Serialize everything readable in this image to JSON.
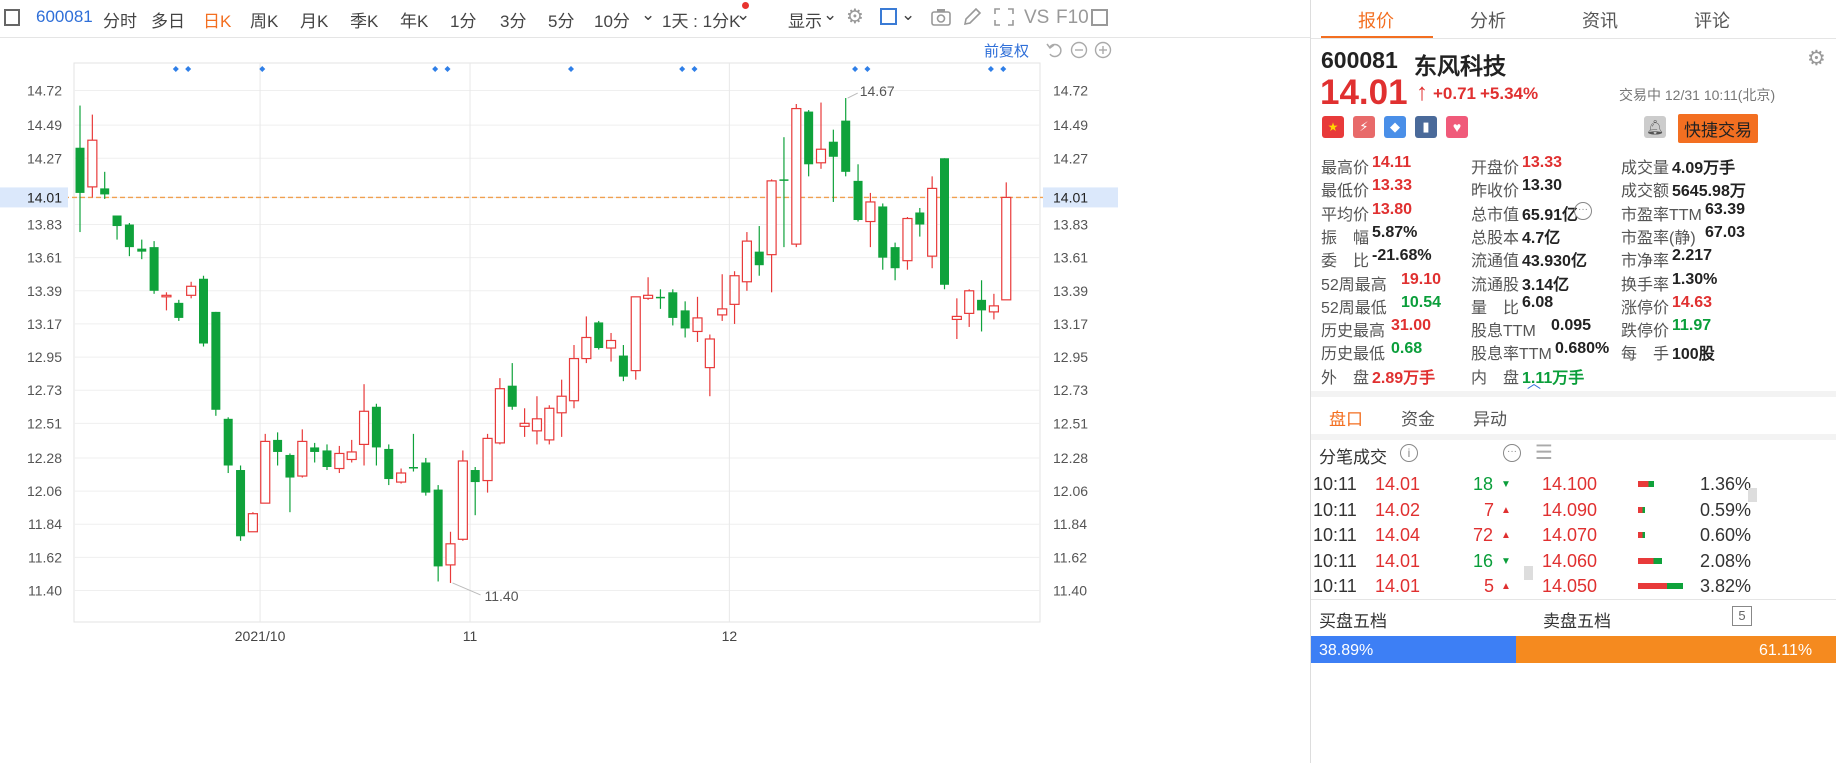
{
  "toolbar": {
    "code": "600081",
    "periods": [
      "分时",
      "多日",
      "日K",
      "周K",
      "月K",
      "季K",
      "年K",
      "1分",
      "3分",
      "5分",
      "10分"
    ],
    "active_period": "日K",
    "interval_select": "1天 : 1分K",
    "display_label": "显示",
    "vs_label": "VS",
    "f10_label": "F10",
    "adj_label": "前复权"
  },
  "chart_data": {
    "type": "candlestick",
    "ylim": [
      11.3,
      14.8
    ],
    "yticks": [
      14.72,
      14.49,
      14.27,
      14.01,
      13.83,
      13.61,
      13.39,
      13.17,
      12.95,
      12.73,
      12.51,
      12.28,
      12.06,
      11.84,
      11.62,
      11.4
    ],
    "xtick_labels": [
      {
        "label": "2021/10",
        "index": 15
      },
      {
        "label": "11",
        "index": 32
      },
      {
        "label": "12",
        "index": 53
      }
    ],
    "last_price_line": 14.01,
    "high_annotation": "14.67",
    "low_annotation": "11.40",
    "candles": [
      [
        14.34,
        14.04,
        14.62,
        13.78
      ],
      [
        14.08,
        14.39,
        14.56,
        14.01
      ],
      [
        14.07,
        14.03,
        14.18,
        14.0
      ],
      [
        13.89,
        13.82,
        13.89,
        13.73
      ],
      [
        13.83,
        13.68,
        13.84,
        13.62
      ],
      [
        13.67,
        13.65,
        13.73,
        13.6
      ],
      [
        13.68,
        13.39,
        13.72,
        13.37
      ],
      [
        13.36,
        13.36,
        13.38,
        13.26
      ],
      [
        13.31,
        13.21,
        13.33,
        13.19
      ],
      [
        13.36,
        13.42,
        13.45,
        13.34
      ],
      [
        13.47,
        13.04,
        13.49,
        13.02
      ],
      [
        13.25,
        12.6,
        13.25,
        12.56
      ],
      [
        12.54,
        12.23,
        12.55,
        12.18
      ],
      [
        12.2,
        11.76,
        12.23,
        11.73
      ],
      [
        11.79,
        11.91,
        11.92,
        11.79
      ],
      [
        11.98,
        12.39,
        12.44,
        11.98
      ],
      [
        12.4,
        12.32,
        12.45,
        12.23
      ],
      [
        12.3,
        12.15,
        12.31,
        11.92
      ],
      [
        12.16,
        12.39,
        12.47,
        12.15
      ],
      [
        12.35,
        12.32,
        12.38,
        12.25
      ],
      [
        12.33,
        12.22,
        12.37,
        12.2
      ],
      [
        12.21,
        12.31,
        12.36,
        12.18
      ],
      [
        12.27,
        12.32,
        12.4,
        12.25
      ],
      [
        12.37,
        12.59,
        12.77,
        12.23
      ],
      [
        12.62,
        12.35,
        12.64,
        12.23
      ],
      [
        12.34,
        12.14,
        12.37,
        12.1
      ],
      [
        12.12,
        12.18,
        12.21,
        12.11
      ],
      [
        12.22,
        12.21,
        12.44,
        12.19
      ],
      [
        12.25,
        12.05,
        12.28,
        12.03
      ],
      [
        12.07,
        11.56,
        12.1,
        11.46
      ],
      [
        11.57,
        11.71,
        11.79,
        11.45
      ],
      [
        11.74,
        12.26,
        12.33,
        11.73
      ],
      [
        12.2,
        12.12,
        12.22,
        11.9
      ],
      [
        12.13,
        12.41,
        12.44,
        12.05
      ],
      [
        12.38,
        12.74,
        12.81,
        12.37
      ],
      [
        12.76,
        12.62,
        12.91,
        12.6
      ],
      [
        12.49,
        12.51,
        12.61,
        12.42
      ],
      [
        12.46,
        12.54,
        12.69,
        12.37
      ],
      [
        12.4,
        12.61,
        12.63,
        12.37
      ],
      [
        12.58,
        12.69,
        12.8,
        12.42
      ],
      [
        12.66,
        12.94,
        13.03,
        12.61
      ],
      [
        12.94,
        13.08,
        13.22,
        12.91
      ],
      [
        13.18,
        13.01,
        13.19,
        13.0
      ],
      [
        13.01,
        13.06,
        13.11,
        12.92
      ],
      [
        12.96,
        12.82,
        13.03,
        12.79
      ],
      [
        12.86,
        13.35,
        13.35,
        12.8
      ],
      [
        13.34,
        13.36,
        13.48,
        13.33
      ],
      [
        13.35,
        13.34,
        13.4,
        13.27
      ],
      [
        13.38,
        13.21,
        13.4,
        13.16
      ],
      [
        13.26,
        13.14,
        13.32,
        13.08
      ],
      [
        13.12,
        13.21,
        13.35,
        13.05
      ],
      [
        12.88,
        13.07,
        13.1,
        12.69
      ],
      [
        13.23,
        13.27,
        13.5,
        13.19
      ],
      [
        13.3,
        13.49,
        13.52,
        13.17
      ],
      [
        13.45,
        13.72,
        13.78,
        13.39
      ],
      [
        13.65,
        13.56,
        13.82,
        13.49
      ],
      [
        13.63,
        14.12,
        14.13,
        13.38
      ],
      [
        14.13,
        14.12,
        14.41,
        13.68
      ],
      [
        13.7,
        14.6,
        14.63,
        13.68
      ],
      [
        14.58,
        14.23,
        14.59,
        14.15
      ],
      [
        14.24,
        14.33,
        14.64,
        14.2
      ],
      [
        14.38,
        14.28,
        14.46,
        13.98
      ],
      [
        14.52,
        14.18,
        14.67,
        14.15
      ],
      [
        14.12,
        13.86,
        14.23,
        13.85
      ],
      [
        13.85,
        13.98,
        14.04,
        13.68
      ],
      [
        13.95,
        13.61,
        13.97,
        13.53
      ],
      [
        13.68,
        13.54,
        13.71,
        13.46
      ],
      [
        13.59,
        13.87,
        13.88,
        13.53
      ],
      [
        13.91,
        13.83,
        13.94,
        13.75
      ],
      [
        13.62,
        14.07,
        14.15,
        13.54
      ],
      [
        14.27,
        13.43,
        14.27,
        13.4
      ],
      [
        13.2,
        13.22,
        13.34,
        13.07
      ],
      [
        13.24,
        13.39,
        13.4,
        13.15
      ],
      [
        13.33,
        13.26,
        13.46,
        13.12
      ],
      [
        13.25,
        13.29,
        13.37,
        13.2
      ],
      [
        13.33,
        14.01,
        14.11,
        13.33
      ]
    ]
  },
  "quote": {
    "code": "600081",
    "name": "东风科技",
    "price": "14.01",
    "change": "+0.71",
    "change_pct": "+5.34%",
    "status": "交易中 12/31 10:11(北京)",
    "quick_trade": "快捷交易"
  },
  "stats": [
    {
      "label": "最高价",
      "value": "14.11",
      "color": "red",
      "col": 0,
      "row": 0
    },
    {
      "label": "开盘价",
      "value": "13.33",
      "color": "red",
      "col": 1,
      "row": 0
    },
    {
      "label": "成交量",
      "value": "4.09万手",
      "color": "dark",
      "col": 2,
      "row": 0
    },
    {
      "label": "最低价",
      "value": "13.33",
      "color": "red",
      "col": 0,
      "row": 1
    },
    {
      "label": "昨收价",
      "value": "13.30",
      "color": "dark",
      "col": 1,
      "row": 1
    },
    {
      "label": "成交额",
      "value": "5645.98万",
      "color": "dark",
      "col": 2,
      "row": 1
    },
    {
      "label": "平均价",
      "value": "13.80",
      "color": "red",
      "col": 0,
      "row": 2
    },
    {
      "label": "总市值",
      "value": "65.91亿",
      "color": "dark",
      "col": 1,
      "row": 2
    },
    {
      "label": "市盈率TTM",
      "value": "63.39",
      "color": "dark",
      "col": 2,
      "row": 2
    },
    {
      "label": "振　幅",
      "value": "5.87%",
      "color": "dark",
      "col": 0,
      "row": 3
    },
    {
      "label": "总股本",
      "value": "4.7亿",
      "color": "dark",
      "col": 1,
      "row": 3
    },
    {
      "label": "市盈率(静)",
      "value": "67.03",
      "color": "dark",
      "col": 2,
      "row": 3
    },
    {
      "label": "委　比",
      "value": "-21.68%",
      "color": "dark",
      "col": 0,
      "row": 4
    },
    {
      "label": "流通值",
      "value": "43.930亿",
      "color": "dark",
      "col": 1,
      "row": 4
    },
    {
      "label": "市净率",
      "value": "2.217",
      "color": "dark",
      "col": 2,
      "row": 4
    },
    {
      "label": "52周最高",
      "value": "19.10",
      "color": "red",
      "col": 0,
      "row": 5
    },
    {
      "label": "流通股",
      "value": "3.14亿",
      "color": "dark",
      "col": 1,
      "row": 5
    },
    {
      "label": "换手率",
      "value": "1.30%",
      "color": "dark",
      "col": 2,
      "row": 5
    },
    {
      "label": "52周最低",
      "value": "10.54",
      "color": "green",
      "col": 0,
      "row": 6
    },
    {
      "label": "量　比",
      "value": "6.08",
      "color": "dark",
      "col": 1,
      "row": 6
    },
    {
      "label": "涨停价",
      "value": "14.63",
      "color": "red",
      "col": 2,
      "row": 6
    },
    {
      "label": "历史最高",
      "value": "31.00",
      "color": "red",
      "col": 0,
      "row": 7
    },
    {
      "label": "股息TTM",
      "value": "0.095",
      "color": "dark",
      "col": 1,
      "row": 7
    },
    {
      "label": "跌停价",
      "value": "11.97",
      "color": "green",
      "col": 2,
      "row": 7
    },
    {
      "label": "历史最低",
      "value": "0.68",
      "color": "green",
      "col": 0,
      "row": 8
    },
    {
      "label": "股息率TTM",
      "value": "0.680%",
      "color": "dark",
      "col": 1,
      "row": 8
    },
    {
      "label": "每　手",
      "value": "100股",
      "color": "dark",
      "col": 2,
      "row": 8
    },
    {
      "label": "外　盘",
      "value": "2.89万手",
      "color": "red",
      "col": 0,
      "row": 9
    },
    {
      "label": "内　盘",
      "value": "1.11万手",
      "color": "green",
      "col": 1,
      "row": 9
    }
  ],
  "right_tabs": [
    "报价",
    "分析",
    "资讯",
    "评论"
  ],
  "sub_tabs": [
    "盘口",
    "资金",
    "异动"
  ],
  "ticks_title": "分笔成交",
  "ticks": [
    {
      "time": "10:11",
      "price": "14.01",
      "vol": "18",
      "dir": "down",
      "level": "14.100",
      "pct": "1.36%",
      "bar": 0.24
    },
    {
      "time": "10:11",
      "price": "14.02",
      "vol": "7",
      "dir": "up",
      "level": "14.090",
      "pct": "0.59%",
      "bar": 0.1
    },
    {
      "time": "10:11",
      "price": "14.04",
      "vol": "72",
      "dir": "up",
      "level": "14.070",
      "pct": "0.60%",
      "bar": 0.11
    },
    {
      "time": "10:11",
      "price": "14.01",
      "vol": "16",
      "dir": "down",
      "level": "14.060",
      "pct": "2.08%",
      "bar": 0.37
    },
    {
      "time": "10:11",
      "price": "14.01",
      "vol": "5",
      "dir": "up",
      "level": "14.050",
      "pct": "3.82%",
      "bar": 0.68
    }
  ],
  "book": {
    "buy_label": "买盘五档",
    "sell_label": "卖盘五档",
    "buy_pct": "38.89%",
    "sell_pct": "61.11%",
    "buy_fraction": 0.3889
  },
  "colors": {
    "up": "#e83a3a",
    "down": "#0fa23b",
    "accent": "#f36f21",
    "link": "#2f6fd8",
    "buy": "#3d7ff5",
    "sell": "#f58a1f"
  }
}
